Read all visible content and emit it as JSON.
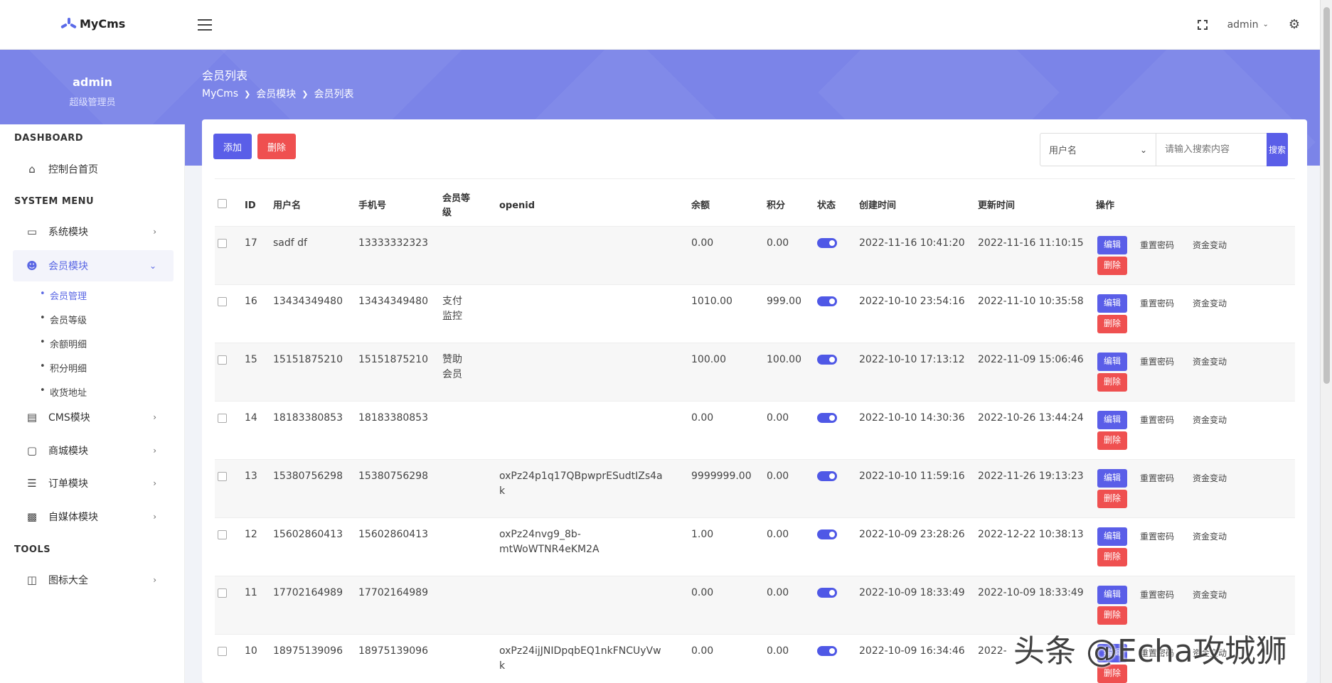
{
  "app": {
    "logo": "MyCms",
    "user": "admin"
  },
  "sidebar": {
    "username": "admin",
    "role": "超级管理员",
    "sections": {
      "dashboard": "DASHBOARD",
      "system": "SYSTEM MENU",
      "tools": "TOOLS"
    },
    "items": [
      {
        "label": "控制台首页"
      },
      {
        "label": "系统模块"
      },
      {
        "label": "会员模块"
      },
      {
        "label": "CMS模块"
      },
      {
        "label": "商城模块"
      },
      {
        "label": "订单模块"
      },
      {
        "label": "自媒体模块"
      },
      {
        "label": "图标大全"
      }
    ],
    "subitems": [
      {
        "label": "会员管理"
      },
      {
        "label": "会员等级"
      },
      {
        "label": "余额明细"
      },
      {
        "label": "积分明细"
      },
      {
        "label": "收货地址"
      }
    ]
  },
  "page": {
    "title": "会员列表",
    "breadcrumb": [
      "MyCms",
      "会员模块",
      "会员列表"
    ]
  },
  "toolbar": {
    "add_label": "添加",
    "delete_label": "删除"
  },
  "search": {
    "field": "用户名",
    "placeholder": "请输入搜索内容",
    "button": "搜索"
  },
  "table": {
    "headers": [
      "ID",
      "用户名",
      "手机号",
      "会员等级",
      "openid",
      "余额",
      "积分",
      "状态",
      "创建时间",
      "更新时间",
      "操作"
    ],
    "actions": {
      "edit": "编辑",
      "reset": "重置密码",
      "fund": "资金变动",
      "delete": "删除"
    },
    "rows": [
      {
        "id": "17",
        "username": "sadf df",
        "phone": "13333332323",
        "level": "",
        "openid": "",
        "balance": "0.00",
        "points": "0.00",
        "status": true,
        "created": "2022-11-16 10:41:20",
        "updated": "2022-11-16 11:10:15"
      },
      {
        "id": "16",
        "username": "13434349480",
        "phone": "13434349480",
        "level": "支付监控",
        "openid": "",
        "balance": "1010.00",
        "points": "999.00",
        "status": true,
        "created": "2022-10-10 23:54:16",
        "updated": "2022-11-10 10:35:58"
      },
      {
        "id": "15",
        "username": "15151875210",
        "phone": "15151875210",
        "level": "赞助会员",
        "openid": "",
        "balance": "100.00",
        "points": "100.00",
        "status": true,
        "created": "2022-10-10 17:13:12",
        "updated": "2022-11-09 15:06:46"
      },
      {
        "id": "14",
        "username": "18183380853",
        "phone": "18183380853",
        "level": "",
        "openid": "",
        "balance": "0.00",
        "points": "0.00",
        "status": true,
        "created": "2022-10-10 14:30:36",
        "updated": "2022-10-26 13:44:24"
      },
      {
        "id": "13",
        "username": "15380756298",
        "phone": "15380756298",
        "level": "",
        "openid": "oxPz24p1q17QBpwprESudtIZs4ak",
        "balance": "9999999.00",
        "points": "0.00",
        "status": true,
        "created": "2022-10-10 11:59:16",
        "updated": "2022-11-26 19:13:23"
      },
      {
        "id": "12",
        "username": "15602860413",
        "phone": "15602860413",
        "level": "",
        "openid": "oxPz24nvg9_8b-mtWoWTNR4eKM2A",
        "balance": "1.00",
        "points": "0.00",
        "status": true,
        "created": "2022-10-09 23:28:26",
        "updated": "2022-12-22 10:38:13"
      },
      {
        "id": "11",
        "username": "17702164989",
        "phone": "17702164989",
        "level": "",
        "openid": "",
        "balance": "0.00",
        "points": "0.00",
        "status": true,
        "created": "2022-10-09 18:33:49",
        "updated": "2022-10-09 18:33:49"
      },
      {
        "id": "10",
        "username": "18975139096",
        "phone": "18975139096",
        "level": "",
        "openid": "oxPz24ijJNIDpqbEQ1nkFNCUyVwk",
        "balance": "0.00",
        "points": "0.00",
        "status": true,
        "created": "2022-10-09 16:34:46",
        "updated": "2022-"
      }
    ]
  },
  "watermark": "头条 @Echa攻城狮",
  "colors": {
    "accent": "#5a5ee8",
    "danger": "#ef5050",
    "banner": "#7b84e8",
    "toggle_on": "#4f58e6"
  }
}
